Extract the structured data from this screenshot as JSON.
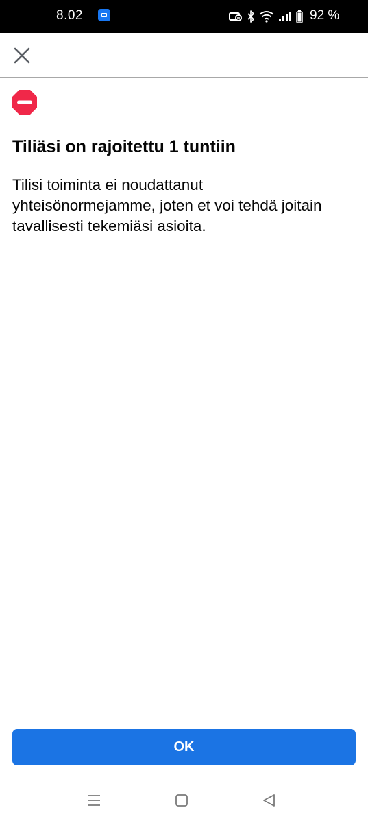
{
  "status_bar": {
    "time": "8.02",
    "battery_percent": "92 %",
    "icons": [
      "facebook-notification-icon",
      "cast-icon",
      "bluetooth-icon",
      "wifi-icon",
      "signal-icon",
      "battery-icon"
    ]
  },
  "top_bar": {
    "close_icon": "close-icon"
  },
  "content": {
    "icon": "restricted-icon",
    "title": "Tiliäsi on rajoitettu 1 tuntiin",
    "body": "Tilisi toiminta ei noudattanut yhteisönormejamme, joten et voi tehdä joitain tavallisesti tekemiäsi asioita."
  },
  "actions": {
    "ok_label": "OK"
  },
  "navigation_bar": {
    "icons": [
      "menu-icon",
      "home-icon",
      "back-icon"
    ]
  },
  "colors": {
    "accent": "#1b74e4",
    "alert_red": "#f02849",
    "status_bar_bg": "#000000"
  }
}
